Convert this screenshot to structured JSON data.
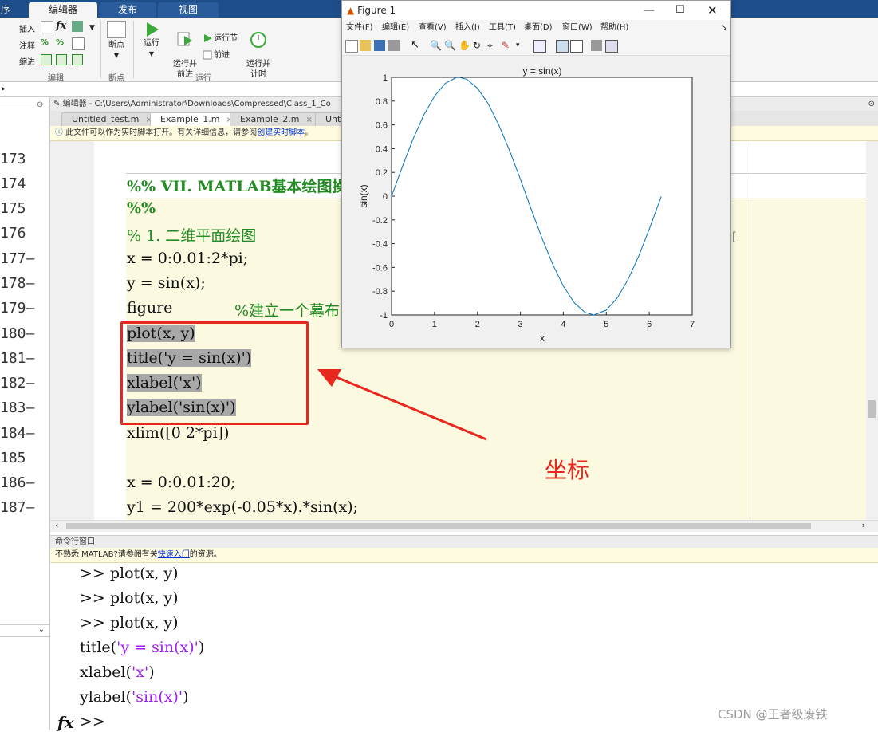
{
  "ribbon": {
    "tabs": [
      "序",
      "编辑器",
      "发布",
      "视图"
    ],
    "insert_label": "插入",
    "comment_label": "注释",
    "indent_label": "缩进",
    "breakpoint_label": "断点",
    "run_label": "运行",
    "run_advance_label": "运行并\n前进",
    "run_section_label": "运行节",
    "advance_label": "前进",
    "run_time_label": "运行并\n计时",
    "group_edit": "编辑",
    "group_breakpoint": "断点",
    "group_run": "运行"
  },
  "editor": {
    "title": "编辑器 - C:\\Users\\Administrator\\Downloads\\Compressed\\Class_1_Co",
    "tabs": [
      {
        "label": "Untitled_test.m"
      },
      {
        "label": "Example_1.m"
      },
      {
        "label": "Example_2.m"
      },
      {
        "label": "Untitl"
      }
    ],
    "info_text": "此文件可以作为实时脚本打开。有关详细信息，请参阅",
    "info_link": "创建实时脚本",
    "info_end": "。",
    "lines": [
      {
        "num": "173",
        "code": ""
      },
      {
        "num": "174",
        "code": "%% VII. MATLAB基本绘图操"
      },
      {
        "num": "175",
        "code": "%%"
      },
      {
        "num": "176",
        "code": "% 1. 二维平面绘图"
      },
      {
        "num": "177—",
        "code": "x = 0:0.01:2*pi;"
      },
      {
        "num": "178—",
        "code": "y = sin(x);"
      },
      {
        "num": "179—",
        "code": "figure"
      },
      {
        "num": "180—",
        "code": "plot(x, y)"
      },
      {
        "num": "181—",
        "code": "title('y = sin(x)')"
      },
      {
        "num": "182—",
        "code": "xlabel('x')"
      },
      {
        "num": "183—",
        "code": "ylabel('sin(x)')"
      },
      {
        "num": "184—",
        "code": "xlim([0 2*pi])"
      },
      {
        "num": "185",
        "code": ""
      },
      {
        "num": "186—",
        "code": "x = 0:0.01:20;"
      },
      {
        "num": "187—",
        "code": "y1 = 200*exp(-0.05*x).*sin(x);"
      }
    ],
    "figure_comment": "%建立一个幕布"
  },
  "command": {
    "title": "命令行窗口",
    "info_text": "不熟悉 MATLAB?请参阅有关",
    "info_link": "快速入门",
    "info_end": "的资源。",
    "prompt": ">>",
    "history": [
      "plot(x, y)",
      "plot(x, y)",
      "plot(x, y)"
    ],
    "title_cmd_a": "title(",
    "title_cmd_s": "'y = sin(x)'",
    "title_cmd_b": ")",
    "xlabel_cmd_a": "xlabel(",
    "xlabel_cmd_s": "'x'",
    "xlabel_cmd_b": ")",
    "ylabel_cmd_a": "ylabel(",
    "ylabel_cmd_s": "'sin(x)'",
    "ylabel_cmd_b": ")",
    "fx": "fx"
  },
  "figure": {
    "title": "Figure 1",
    "menu": [
      "文件(F)",
      "编辑(E)",
      "查看(V)",
      "插入(I)",
      "工具(T)",
      "桌面(D)",
      "窗口(W)",
      "帮助(H)"
    ]
  },
  "chart_data": {
    "type": "line",
    "title": "y = sin(x)",
    "xlabel": "x",
    "ylabel": "sin(x)",
    "xlim": [
      0,
      7
    ],
    "ylim": [
      -1,
      1
    ],
    "xticks": [
      "0",
      "1",
      "2",
      "3",
      "4",
      "5",
      "6",
      "7"
    ],
    "yticks": [
      "1",
      "0.8",
      "0.6",
      "0.4",
      "0.2",
      "0",
      "-0.2",
      "-0.4",
      "-0.6",
      "-0.8",
      "-1"
    ],
    "series": [
      {
        "x": [
          0,
          0.25,
          0.5,
          0.75,
          1.0,
          1.25,
          1.5,
          1.571,
          1.75,
          2.0,
          2.25,
          2.5,
          2.75,
          3.0,
          3.25,
          3.5,
          3.75,
          4.0,
          4.25,
          4.5,
          4.712,
          5.0,
          5.25,
          5.5,
          5.75,
          6.0,
          6.28
        ],
        "y": [
          0,
          0.247,
          0.479,
          0.682,
          0.841,
          0.949,
          0.997,
          1.0,
          0.984,
          0.909,
          0.778,
          0.598,
          0.382,
          0.141,
          -0.108,
          -0.351,
          -0.572,
          -0.757,
          -0.895,
          -0.978,
          -1.0,
          -0.959,
          -0.859,
          -0.706,
          -0.508,
          -0.279,
          -0.003
        ]
      }
    ],
    "line_color": "#0072bd",
    "grid": false
  },
  "annotation": {
    "text": "坐标",
    "color": "#e8281e"
  },
  "watermark": "CSDN @王者级废铁"
}
